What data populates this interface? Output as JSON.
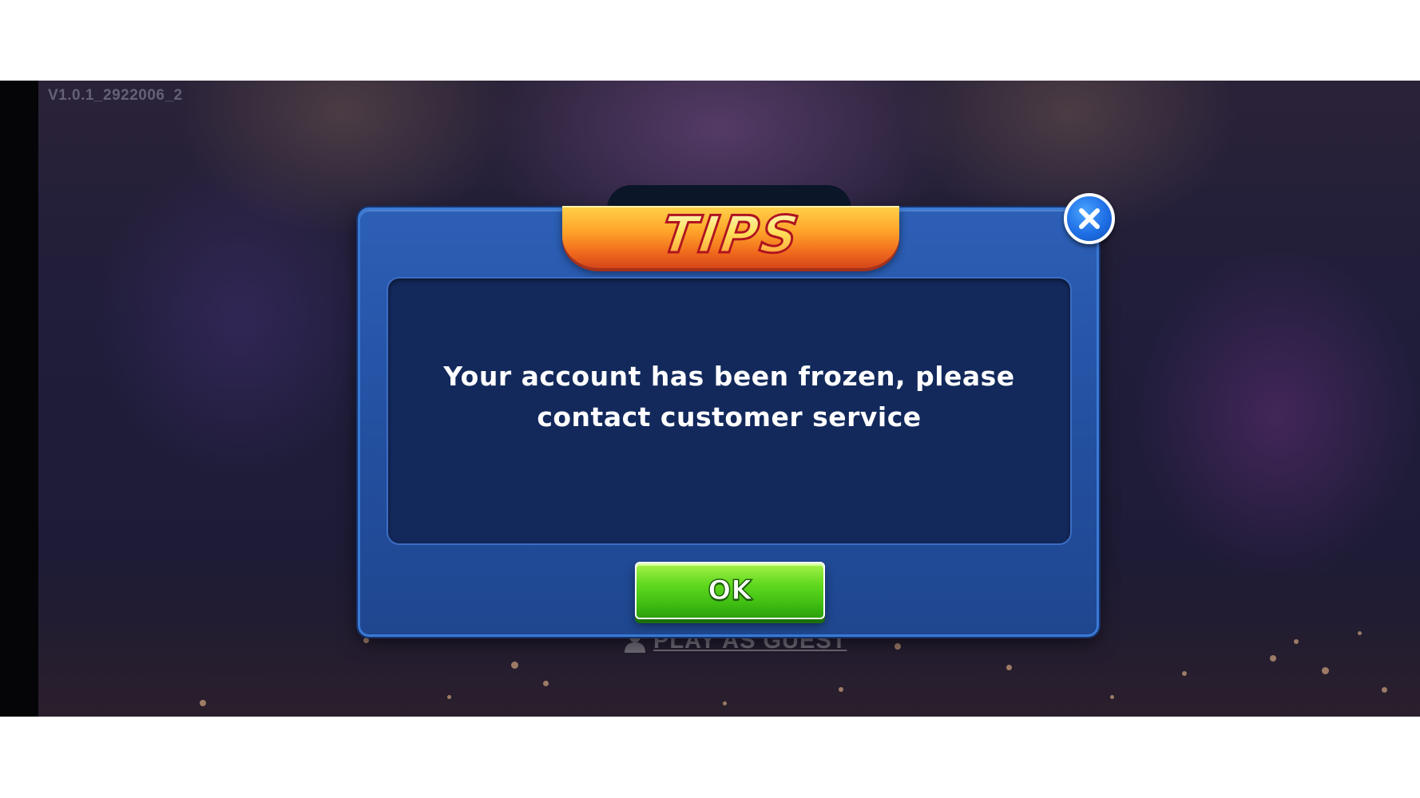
{
  "app": {
    "version": "V1.0.1_2922006_2"
  },
  "background": {
    "guest_link_label": "PLAY AS GUEST",
    "guest_icon": "person-icon"
  },
  "dialog": {
    "title": "TIPS",
    "message": "Your account has been frozen, please contact customer service",
    "ok_label": "OK",
    "close_icon": "close-icon"
  },
  "colors": {
    "dialog_blue": "#2c5fb6",
    "panel_navy": "#13295c",
    "ok_green": "#5fd81e",
    "title_orange": "#ffa52a",
    "title_outline_red": "#b0131f",
    "close_blue": "#1f6fe6"
  }
}
